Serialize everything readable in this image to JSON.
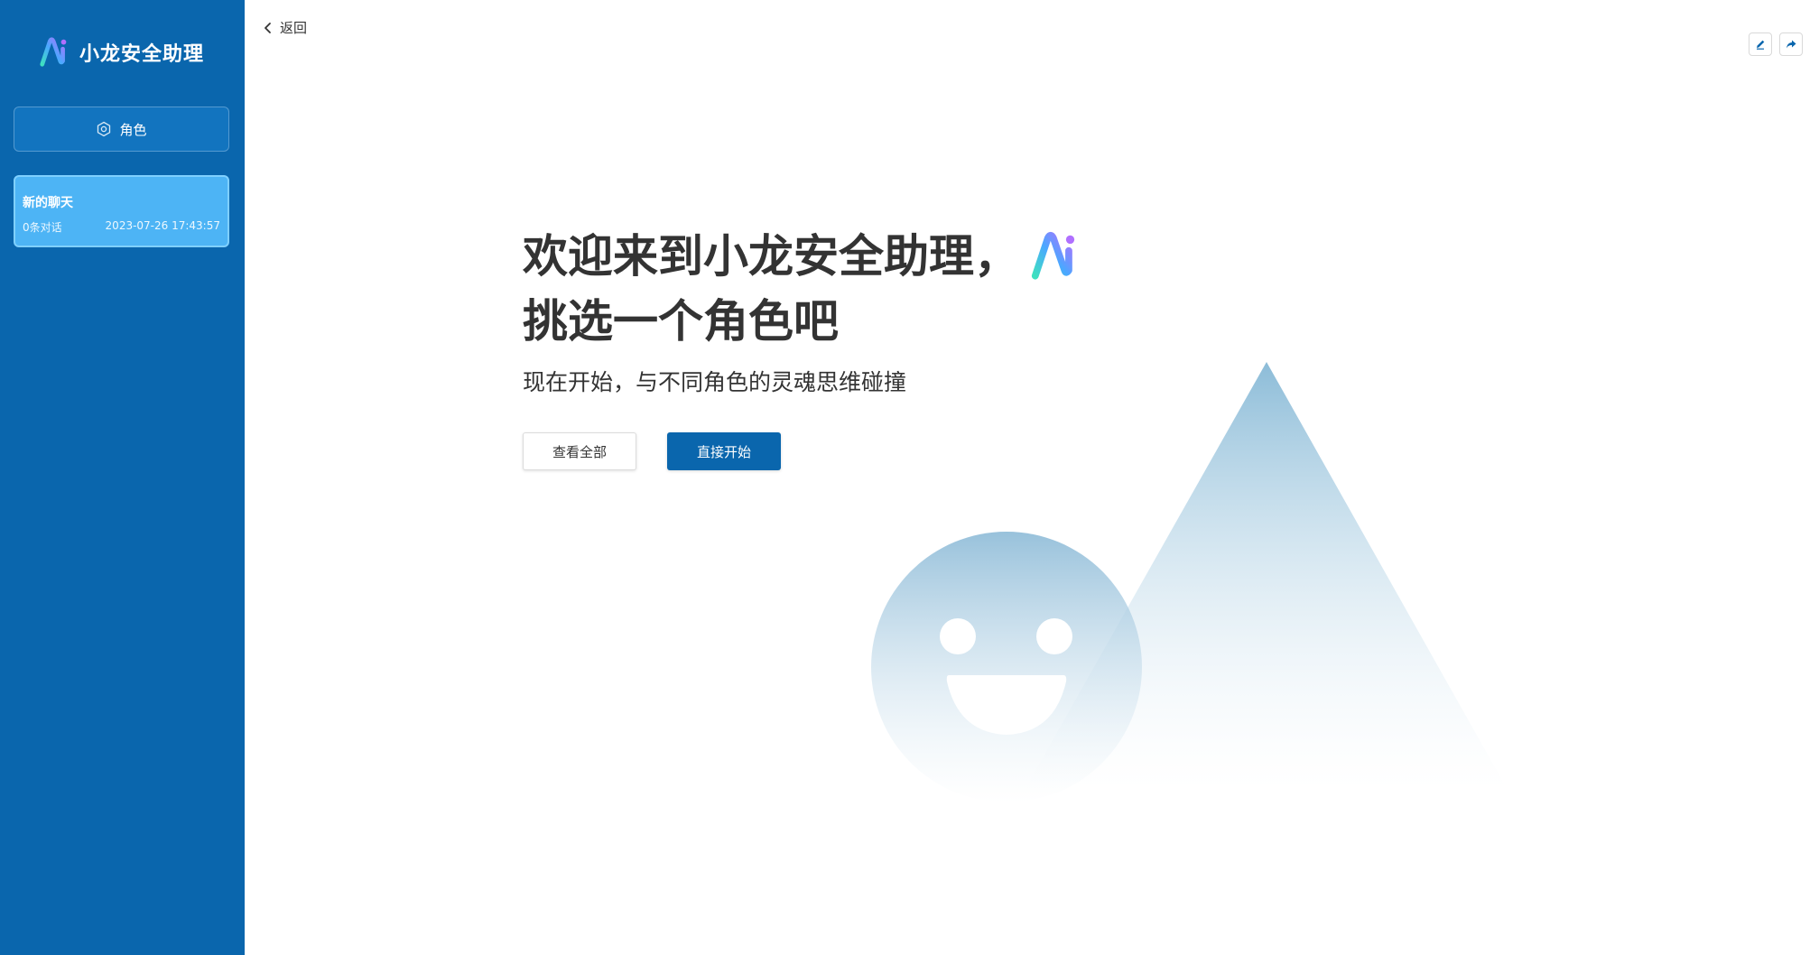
{
  "sidebar": {
    "logo_text": "小龙安全助理",
    "role_button_label": "角色",
    "role_icon": "hexagon-settings-icon",
    "chats": [
      {
        "title": "新的聊天",
        "count": "0条对话",
        "time": "2023-07-26 17:43:57"
      }
    ]
  },
  "header": {
    "back_label": "返回",
    "back_icon": "chevron-left-icon",
    "actions": [
      {
        "icon": "edit-icon"
      },
      {
        "icon": "share-icon"
      }
    ]
  },
  "main": {
    "headline_line1": "欢迎来到小龙安全助理，",
    "headline_line2": "挑选一个角色吧",
    "subline": "现在开始，与不同角色的灵魂思维碰撞",
    "view_all_label": "查看全部",
    "start_label": "直接开始"
  },
  "colors": {
    "sidebar_bg": "#0a66ad",
    "accent": "#0a66ad",
    "active_chat_bg": "#4db4f5"
  }
}
